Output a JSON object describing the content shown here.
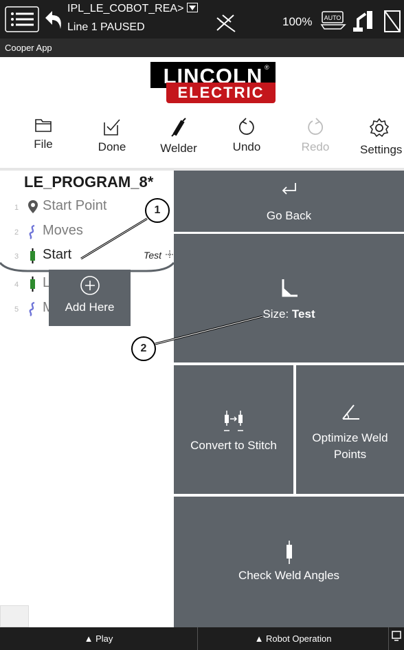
{
  "status": {
    "program_name": "IPL_LE_COBOT_REA>",
    "line_state": "Line 1 PAUSED",
    "speed": "100%",
    "mode_badge": "AUTO"
  },
  "app_bar": {
    "title": "Cooper App"
  },
  "logo": {
    "line1": "LINCOLN",
    "line2": "ELECTRIC",
    "reg": "®"
  },
  "toolbar": {
    "file": "File",
    "done": "Done",
    "welder": "Welder",
    "undo": "Undo",
    "redo": "Redo",
    "settings": "Settings"
  },
  "program": {
    "title": "LE_PROGRAM_8*",
    "lines": [
      {
        "num": "1",
        "label": "Start Point",
        "icon": "location-pin-icon"
      },
      {
        "num": "2",
        "label": "Moves",
        "icon": "path-icon"
      },
      {
        "num": "3",
        "label": "Start",
        "tag": "Test",
        "icon": "torch-icon"
      },
      {
        "num": "4",
        "label": "L",
        "icon": "torch-icon"
      },
      {
        "num": "5",
        "label": "M",
        "icon": "path-icon"
      }
    ],
    "add_here": "Add Here"
  },
  "tiles": {
    "go_back": "Go Back",
    "size_label": "Size: ",
    "size_value": "Test",
    "convert": "Convert to Stitch",
    "optimize_line1": "Optimize Weld",
    "optimize_line2": "Points",
    "check": "Check Weld Angles"
  },
  "bottom_bar": {
    "play": "▲ Play",
    "robot_operation": "▲ Robot Operation"
  },
  "callouts": [
    "1",
    "2"
  ],
  "colors": {
    "tile_bg": "#5d6369",
    "brand_red": "#c4161c",
    "torch_green": "#2e8b2e",
    "path_blue": "#6f75d8"
  }
}
